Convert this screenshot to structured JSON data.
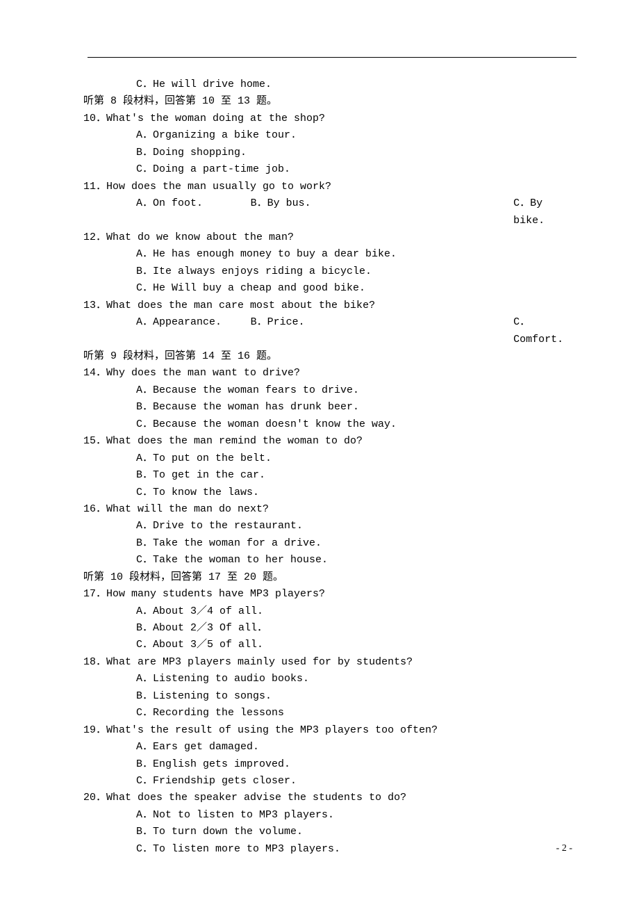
{
  "pagenum": "- 2 -",
  "lines": [
    {
      "cls": "indent2",
      "text": "C．He will drive home."
    },
    {
      "cls": "indent0",
      "text": "听第 8 段材料，回答第 10 至 13 题。"
    },
    {
      "cls": "indent0",
      "text": "10．What's the woman doing at the shop?"
    },
    {
      "cls": "indent2",
      "text": "A．Organizing a bike tour."
    },
    {
      "cls": "indent2",
      "text": "B．Doing shopping."
    },
    {
      "cls": "indent2",
      "text": "C．Doing a part-time job."
    },
    {
      "cls": "indent0",
      "text": "11．How does the man usually go to work?"
    },
    {
      "cls": "optline",
      "a": "A．On foot.",
      "b": "B．By bus.",
      "c": "C．By bike."
    },
    {
      "cls": "indent0",
      "text": "12．What do we know about the man?"
    },
    {
      "cls": "indent2",
      "text": "A．He has enough money to buy a dear bike."
    },
    {
      "cls": "indent2",
      "text": "B．Ite always enjoys riding a bicycle."
    },
    {
      "cls": "indent2",
      "text": "C．He Will buy a cheap and good bike."
    },
    {
      "cls": "indent0",
      "text": "13．What does the man care most about the bike?"
    },
    {
      "cls": "optline",
      "a": "A．Appearance.",
      "b": "B．Price.",
      "c": "C．Comfort."
    },
    {
      "cls": "indent0",
      "text": "听第 9 段材料，回答第 14 至 16 题。"
    },
    {
      "cls": "indent0",
      "text": "14．Why does the man want to drive?"
    },
    {
      "cls": "indent2",
      "text": "A．Because the woman fears to drive."
    },
    {
      "cls": "indent2",
      "text": "B．Because the woman has drunk beer."
    },
    {
      "cls": "indent2",
      "text": "C．Because the woman doesn't know the way."
    },
    {
      "cls": "indent0",
      "text": "15．What does the man remind the woman to do?"
    },
    {
      "cls": "indent2",
      "text": "A．To put on the belt."
    },
    {
      "cls": "indent2",
      "text": "B．To get in the car."
    },
    {
      "cls": "indent2",
      "text": "C．To know the laws."
    },
    {
      "cls": "indent0",
      "text": "16．What will the man do next?"
    },
    {
      "cls": "indent2",
      "text": "A．Drive to the restaurant."
    },
    {
      "cls": "indent2",
      "text": "B．Take the woman for a drive."
    },
    {
      "cls": "indent2",
      "text": "C．Take the woman to her house."
    },
    {
      "cls": "indent0",
      "text": "听第 10 段材料，回答第 17 至 20 题。"
    },
    {
      "cls": "indent0",
      "text": "17．How many students have MP3 players?"
    },
    {
      "cls": "indent2",
      "text": "A．About 3／4 of all."
    },
    {
      "cls": "indent2",
      "text": "B．About 2／3 Of all．"
    },
    {
      "cls": "indent2",
      "text": "C．About 3／5 of all."
    },
    {
      "cls": "indent0",
      "text": "18．What are MP3 players mainly used for by students?"
    },
    {
      "cls": "indent2",
      "text": "A．Listening to audio books."
    },
    {
      "cls": "indent2",
      "text": "B．Listening to songs."
    },
    {
      "cls": "indent2",
      "text": "C．Recording the lessons"
    },
    {
      "cls": "indent0",
      "text": "19．What's the result of using the MP3 players too often?"
    },
    {
      "cls": "indent2",
      "text": "A．Ears get damaged."
    },
    {
      "cls": "indent2",
      "text": "B．English gets improved."
    },
    {
      "cls": "indent2",
      "text": "C．Friendship gets closer."
    },
    {
      "cls": "indent0",
      "text": "20．What does the speaker advise the students to do?"
    },
    {
      "cls": "indent2",
      "text": "A．Not to listen to MP3 players."
    },
    {
      "cls": "indent2",
      "text": "B．To turn down the volume."
    },
    {
      "cls": "indent2",
      "text": "C．To listen more to MP3 players."
    }
  ]
}
